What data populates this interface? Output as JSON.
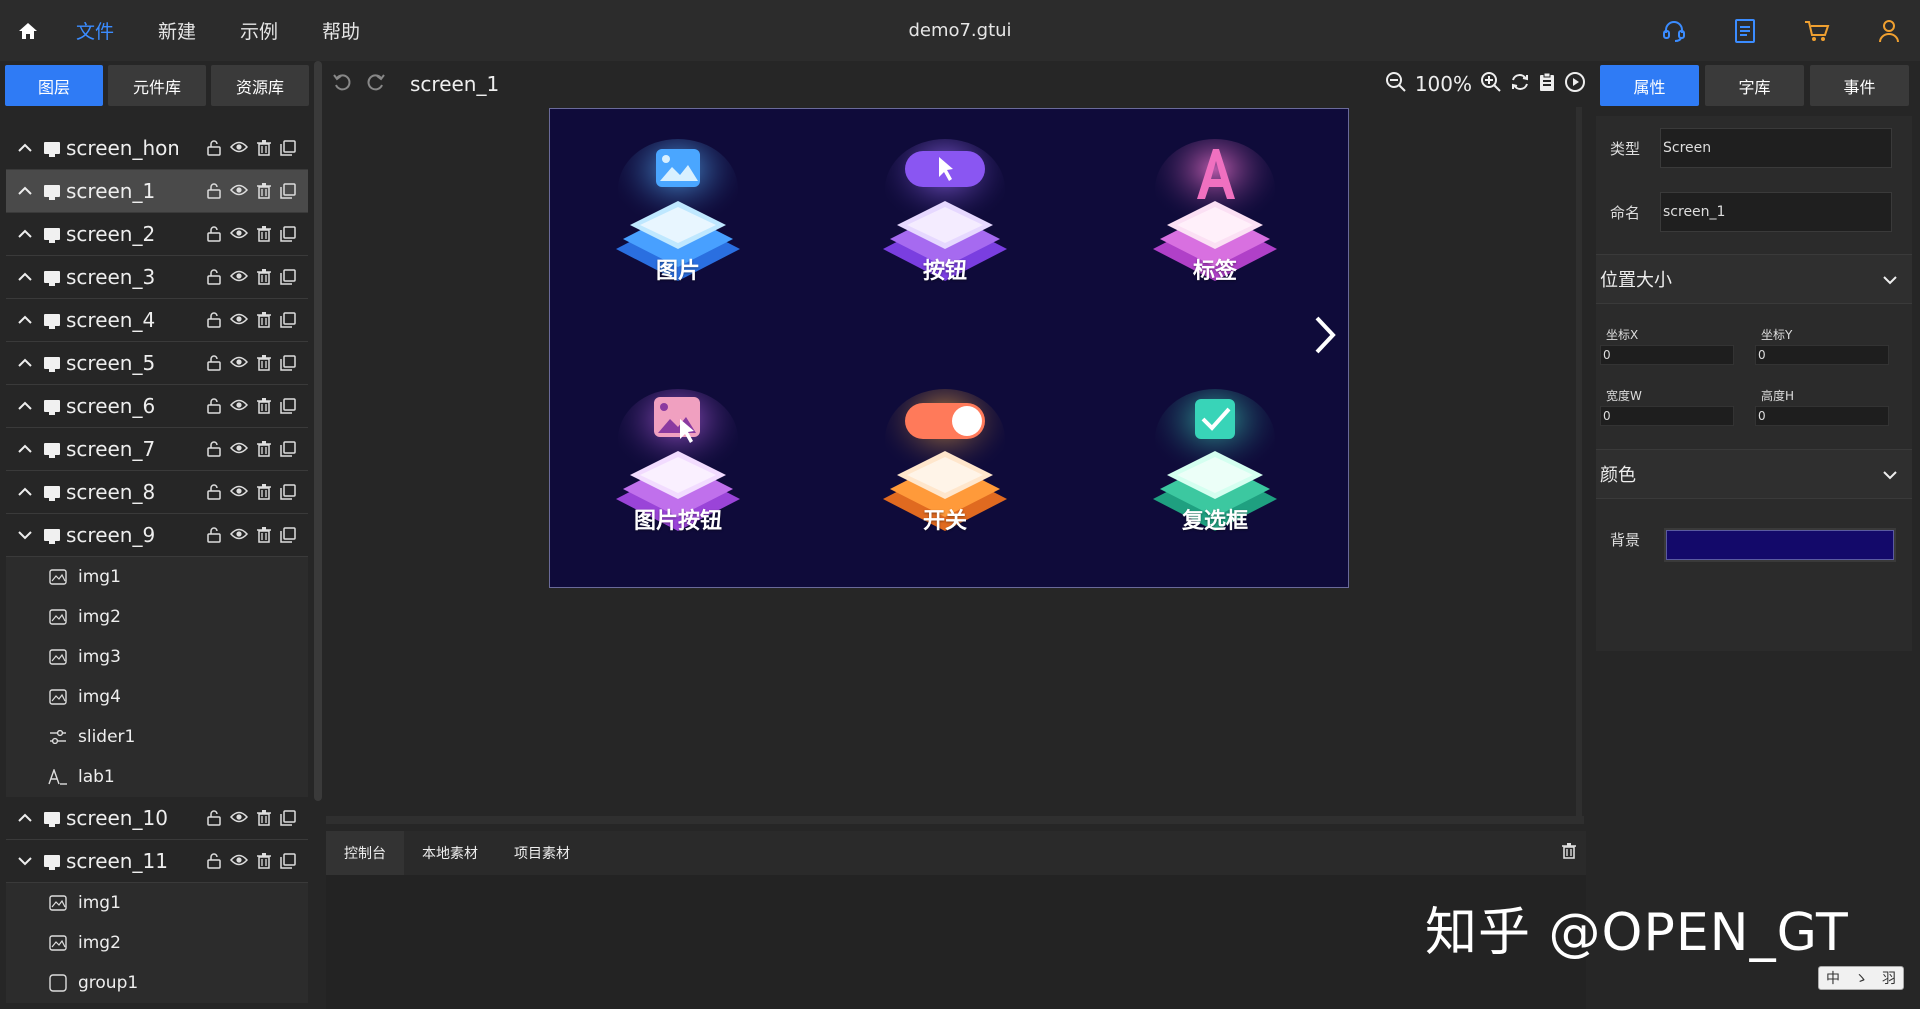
{
  "topbar": {
    "menu": [
      {
        "label": "文件",
        "active": true
      },
      {
        "label": "新建",
        "active": false
      },
      {
        "label": "示例",
        "active": false
      },
      {
        "label": "帮助",
        "active": false
      }
    ],
    "file_title": "demo7.gtui",
    "right_icons": [
      "headset-icon",
      "document-icon",
      "cart-icon",
      "user-icon"
    ],
    "accent": "#f0a030"
  },
  "left_panel": {
    "tabs": [
      {
        "label": "图层",
        "active": true
      },
      {
        "label": "元件库",
        "active": false
      },
      {
        "label": "资源库",
        "active": false
      }
    ],
    "screens": [
      {
        "name": "screen_hom",
        "expanded": false,
        "selected": false
      },
      {
        "name": "screen_1",
        "expanded": false,
        "selected": true
      },
      {
        "name": "screen_2",
        "expanded": false
      },
      {
        "name": "screen_3",
        "expanded": false
      },
      {
        "name": "screen_4",
        "expanded": false
      },
      {
        "name": "screen_5",
        "expanded": false
      },
      {
        "name": "screen_6",
        "expanded": false
      },
      {
        "name": "screen_7",
        "expanded": false
      },
      {
        "name": "screen_8",
        "expanded": false
      },
      {
        "name": "screen_9",
        "expanded": true,
        "children": [
          {
            "name": "img1",
            "icon": "image-icon"
          },
          {
            "name": "img2",
            "icon": "image-icon"
          },
          {
            "name": "img3",
            "icon": "image-icon"
          },
          {
            "name": "img4",
            "icon": "image-icon"
          },
          {
            "name": "slider1",
            "icon": "slider-icon"
          },
          {
            "name": "lab1",
            "icon": "label-icon"
          }
        ]
      },
      {
        "name": "screen_10",
        "expanded": false
      },
      {
        "name": "screen_11",
        "expanded": true,
        "children": [
          {
            "name": "img1",
            "icon": "image-icon"
          },
          {
            "name": "img2",
            "icon": "image-icon"
          },
          {
            "name": "group1",
            "icon": "group-icon"
          }
        ]
      }
    ]
  },
  "canvas": {
    "screen_name": "screen_1",
    "zoom": "100%",
    "background": "#0f0b3a",
    "tiles": [
      {
        "label": "图片",
        "color": "#3aa8ff"
      },
      {
        "label": "按钮",
        "color": "#9c5cf0"
      },
      {
        "label": "标签",
        "color": "#e06ad0"
      },
      {
        "label": "图片按钮",
        "color": "#c46ae6"
      },
      {
        "label": "开关",
        "color": "#ff9a3a"
      },
      {
        "label": "复选框",
        "color": "#3cc8a0"
      }
    ]
  },
  "console": {
    "tabs": [
      {
        "label": "控制台",
        "active": true
      },
      {
        "label": "本地素材",
        "active": false
      },
      {
        "label": "项目素材",
        "active": false
      }
    ]
  },
  "right_panel": {
    "tabs": [
      {
        "label": "属性",
        "active": true
      },
      {
        "label": "字库",
        "active": false
      },
      {
        "label": "事件",
        "active": false
      }
    ],
    "type_label": "类型",
    "type_value": "Screen",
    "name_label": "命名",
    "name_value": "screen_1",
    "section_pos": "位置大小",
    "x_label": "坐标X",
    "x_value": "0",
    "y_label": "坐标Y",
    "y_value": "0",
    "w_label": "宽度W",
    "w_value": "0",
    "h_label": "高度H",
    "h_value": "0",
    "section_color": "颜色",
    "bg_label": "背景",
    "bg_color": "#13096a"
  },
  "overlay": {
    "watermark": "知乎 @OPEN_GT",
    "ime": [
      "中",
      "ゝ",
      "羽"
    ]
  }
}
